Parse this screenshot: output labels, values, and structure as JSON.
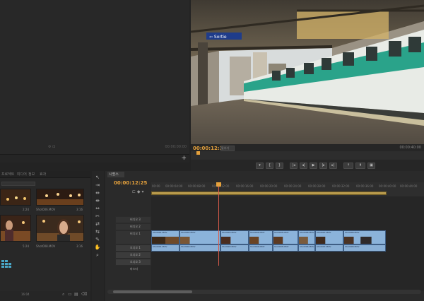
{
  "source": {
    "timecode": "00:00:00:00",
    "footer_icons": [
      "settings-icon",
      "export-frame-icon"
    ],
    "add_button": "+"
  },
  "program": {
    "timecode": "00:00:12:25",
    "fit_label": "맞추기",
    "total": "00:00:40:00",
    "controls": [
      "marker-icon",
      "in-point-icon",
      "out-point-icon",
      "go-to-in-icon",
      "step-back-icon",
      "play-icon",
      "step-forward-icon",
      "go-to-out-icon",
      "lift-icon",
      "extract-icon",
      "export-frame-icon"
    ]
  },
  "project": {
    "tabs": [
      "프로젝트",
      "미디어",
      "정보",
      "효과"
    ],
    "items": [
      {
        "label": "",
        "duration": "2:24"
      },
      {
        "label": "Shot006.MOV",
        "duration": "3:16"
      },
      {
        "label": "",
        "duration": "5:24"
      },
      {
        "label": "Shot008.MOV",
        "duration": "3:16"
      }
    ],
    "footer_count": "16:04"
  },
  "tools": [
    "selection-tool-icon",
    "track-select-icon",
    "ripple-edit-icon",
    "rolling-edit-icon",
    "rate-stretch-icon",
    "razor-icon",
    "slip-icon",
    "slide-icon",
    "pen-icon",
    "hand-icon",
    "zoom-icon"
  ],
  "timeline": {
    "tab": "시퀀스",
    "timecode": "00:00:12:25",
    "ruler_ticks": [
      "00:00",
      "00:00:04:00",
      "00:00:08:00",
      "00:00:12:00",
      "00:00:16:00",
      "00:00:20:00",
      "00:00:24:00",
      "00:00:28:00",
      "00:00:32:00",
      "00:00:36:00",
      "00:00:40:00",
      "00:00:44:00",
      "00:00:48:00"
    ],
    "tracks": [
      {
        "name": "비디오 3"
      },
      {
        "name": "비디오 2"
      },
      {
        "name": "비디오 1"
      },
      {
        "name": "오디오 1"
      },
      {
        "name": "오디오 2"
      },
      {
        "name": "오디오 3"
      },
      {
        "name": "마스터"
      }
    ],
    "video_clips": [
      "Shot001.MOV",
      "Shot002.MOV",
      "Shot003.MOV",
      "Shot004.MOV",
      "Shot005.MOV",
      "Shot006.MOV",
      "Shot007.MOV",
      "Shot008.MOV"
    ],
    "audio_clips": [
      "Shot001.MOV",
      "Shot002.MOV",
      "Shot003.MOV",
      "Shot004.MOV",
      "Shot005.MOV",
      "Shot006.MOV",
      "Shot007.MOV",
      "Shot008.MOV"
    ]
  },
  "colors": {
    "accent": "#e5a13c",
    "clip_blue": "#8bb3da",
    "playhead": "#d95b4a",
    "metro_green": "#2aa38a"
  }
}
